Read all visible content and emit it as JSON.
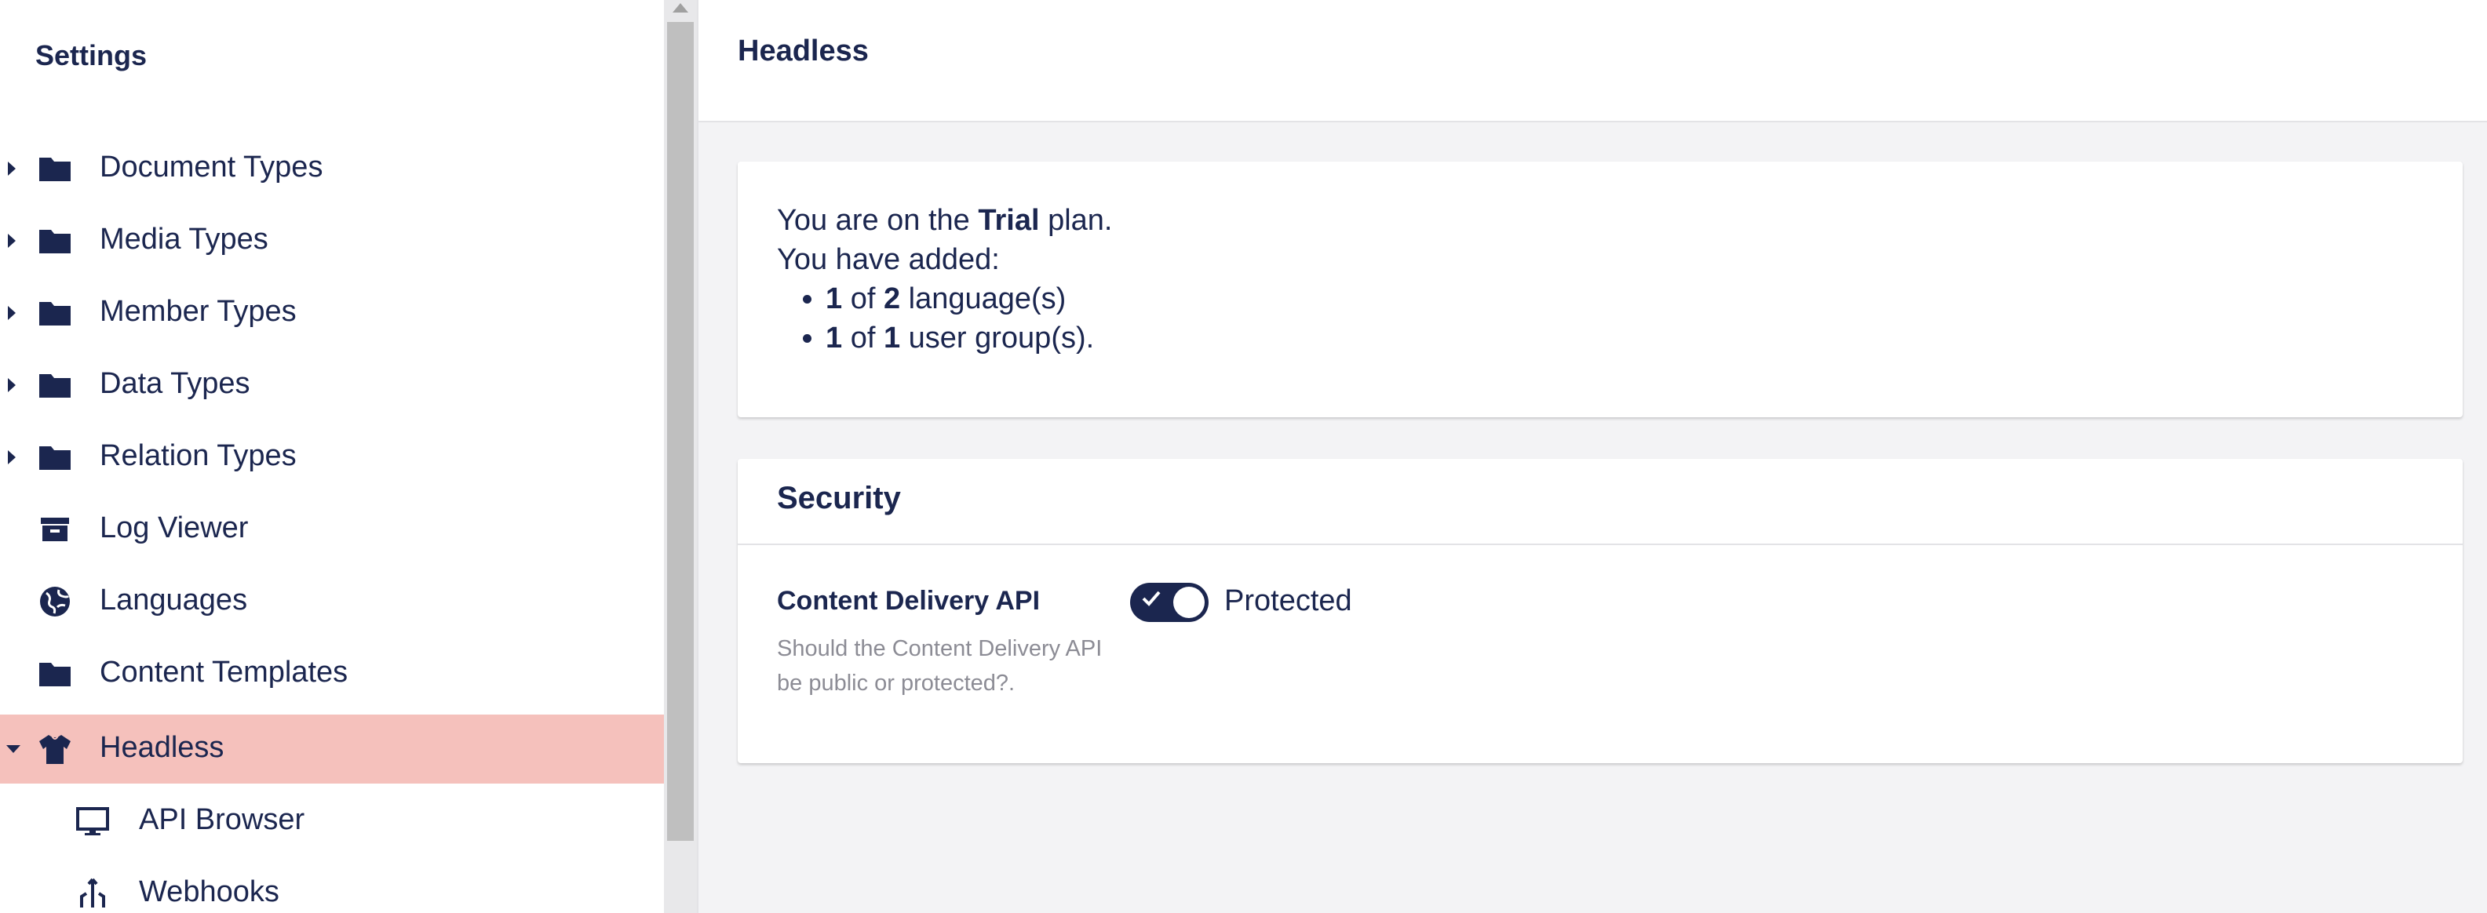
{
  "sidebar": {
    "title": "Settings",
    "items": [
      {
        "label": "Document Types",
        "icon": "folder-icon",
        "expandable": true
      },
      {
        "label": "Media Types",
        "icon": "folder-icon",
        "expandable": true
      },
      {
        "label": "Member Types",
        "icon": "folder-icon",
        "expandable": true
      },
      {
        "label": "Data Types",
        "icon": "folder-icon",
        "expandable": true
      },
      {
        "label": "Relation Types",
        "icon": "folder-icon",
        "expandable": true
      },
      {
        "label": "Log Viewer",
        "icon": "archive-icon",
        "expandable": false
      },
      {
        "label": "Languages",
        "icon": "globe-icon",
        "expandable": false
      },
      {
        "label": "Content Templates",
        "icon": "folder-icon",
        "expandable": false
      },
      {
        "label": "Headless",
        "icon": "headless-icon",
        "expandable": true,
        "expanded": true,
        "active": true
      },
      {
        "label": "API Browser",
        "icon": "monitor-icon",
        "child": true
      },
      {
        "label": "Webhooks",
        "icon": "webhook-icon",
        "child": true
      }
    ]
  },
  "header": {
    "title": "Headless"
  },
  "plan": {
    "line1_prefix": "You are on the ",
    "plan_name": "Trial",
    "line1_suffix": " plan.",
    "line2": "You have added:",
    "languages_used": "1",
    "languages_of": " of ",
    "languages_max": "2",
    "languages_suffix": " language(s)",
    "groups_used": "1",
    "groups_of": " of ",
    "groups_max": "1",
    "groups_suffix": " user group(s)."
  },
  "security": {
    "title": "Security",
    "property_label": "Content Delivery API",
    "property_description": "Should the Content Delivery API be public or protected?.",
    "toggle_label": "Protected",
    "toggle_on": true
  },
  "colors": {
    "primary": "#1b264f",
    "active_bg": "#f5c1bc",
    "page_bg": "#f3f3f5",
    "muted_text": "#8c8c95"
  }
}
